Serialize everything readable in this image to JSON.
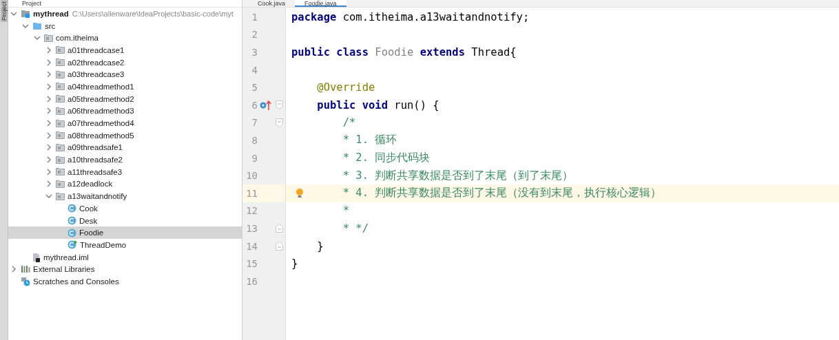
{
  "tool_strip": {
    "label": "Project"
  },
  "project_panel": {
    "title": "Project",
    "tree": [
      {
        "kind": "module",
        "label": "mythread",
        "path": "C:\\Users\\alienware\\IdeaProjects\\basic-code\\myt",
        "expanded": true,
        "selected": false,
        "children": [
          {
            "kind": "source",
            "label": "src",
            "expanded": true,
            "selected": false,
            "children": [
              {
                "kind": "package",
                "label": "com.itheima",
                "expanded": true,
                "selected": false,
                "children": [
                  {
                    "kind": "package",
                    "label": "a01threadcase1",
                    "expanded": false,
                    "selected": false
                  },
                  {
                    "kind": "package",
                    "label": "a02threadcase2",
                    "expanded": false,
                    "selected": false
                  },
                  {
                    "kind": "package",
                    "label": "a03threadcase3",
                    "expanded": false,
                    "selected": false
                  },
                  {
                    "kind": "package",
                    "label": "a04threadmethod1",
                    "expanded": false,
                    "selected": false
                  },
                  {
                    "kind": "package",
                    "label": "a05threadmethod2",
                    "expanded": false,
                    "selected": false
                  },
                  {
                    "kind": "package",
                    "label": "a06threadmethod3",
                    "expanded": false,
                    "selected": false
                  },
                  {
                    "kind": "package",
                    "label": "a07threadmethod4",
                    "expanded": false,
                    "selected": false
                  },
                  {
                    "kind": "package",
                    "label": "a08threadmethod5",
                    "expanded": false,
                    "selected": false
                  },
                  {
                    "kind": "package",
                    "label": "a09threadsafe1",
                    "expanded": false,
                    "selected": false
                  },
                  {
                    "kind": "package",
                    "label": "a10threadsafe2",
                    "expanded": false,
                    "selected": false
                  },
                  {
                    "kind": "package",
                    "label": "a11threadsafe3",
                    "expanded": false,
                    "selected": false
                  },
                  {
                    "kind": "package",
                    "label": "a12deadlock",
                    "expanded": false,
                    "selected": false
                  },
                  {
                    "kind": "package",
                    "label": "a13waitandnotify",
                    "expanded": true,
                    "selected": false,
                    "children": [
                      {
                        "kind": "class",
                        "label": "Cook",
                        "selected": false
                      },
                      {
                        "kind": "class",
                        "label": "Desk",
                        "selected": false
                      },
                      {
                        "kind": "class",
                        "label": "Foodie",
                        "selected": true
                      },
                      {
                        "kind": "main",
                        "label": "ThreadDemo",
                        "selected": false
                      }
                    ]
                  }
                ]
              }
            ]
          },
          {
            "kind": "file",
            "label": "mythread.iml",
            "selected": false
          }
        ]
      },
      {
        "kind": "libraries",
        "label": "External Libraries",
        "expanded": false,
        "selected": false
      },
      {
        "kind": "scratches",
        "label": "Scratches and Consoles",
        "selected": false
      }
    ]
  },
  "editor_tabs": [
    {
      "label": "Cook.java",
      "selected": false
    },
    {
      "label": "Foodie.java",
      "selected": true
    }
  ],
  "code_lines": [
    {
      "number": "1",
      "tokens": [
        {
          "kind": "keyword",
          "text": "package"
        },
        {
          "kind": "plain",
          "text": " com.itheima.a13waitandnotify;"
        }
      ]
    },
    {
      "number": "2"
    },
    {
      "number": "3",
      "tokens": [
        {
          "kind": "keyword",
          "text": "public class"
        },
        {
          "kind": "type",
          "text": " Foodie"
        },
        {
          "kind": "keyword",
          "text": " extends"
        },
        {
          "kind": "plain",
          "text": " Thread{"
        }
      ]
    },
    {
      "number": "4"
    },
    {
      "number": "5",
      "tokens": [
        {
          "kind": "annotation",
          "text": "    @Override"
        }
      ]
    },
    {
      "number": "6",
      "override_marker": true,
      "fold_start": true,
      "tokens": [
        {
          "kind": "keyword",
          "text": "    public void"
        },
        {
          "kind": "plain",
          "text": " run() {"
        }
      ]
    },
    {
      "number": "7",
      "fold_start": true,
      "tokens": [
        {
          "kind": "comment",
          "text": "        /*"
        }
      ]
    },
    {
      "number": "8",
      "tokens": [
        {
          "kind": "comment",
          "text": "        * 1. 循环"
        }
      ]
    },
    {
      "number": "9",
      "tokens": [
        {
          "kind": "comment",
          "text": "        * 2. 同步代码块"
        }
      ]
    },
    {
      "number": "10",
      "tokens": [
        {
          "kind": "comment",
          "text": "        * 3. 判断共享数据是否到了末尾（到了末尾）"
        }
      ]
    },
    {
      "number": "11",
      "current": true,
      "bulb": true,
      "tokens": [
        {
          "kind": "comment",
          "text": "        * 4. 判断共享数据是否到了末尾（没有到末尾，执行核心逻辑）"
        }
      ]
    },
    {
      "number": "12",
      "tokens": [
        {
          "kind": "comment",
          "text": "        *"
        }
      ]
    },
    {
      "number": "13",
      "fold_end": true,
      "tokens": [
        {
          "kind": "comment",
          "text": "        * */"
        }
      ]
    },
    {
      "number": "14",
      "fold_end": true,
      "tokens": [
        {
          "kind": "plain",
          "text": "    }"
        }
      ]
    },
    {
      "number": "15",
      "tokens": [
        {
          "kind": "plain",
          "text": "}"
        }
      ]
    },
    {
      "number": "16"
    }
  ]
}
